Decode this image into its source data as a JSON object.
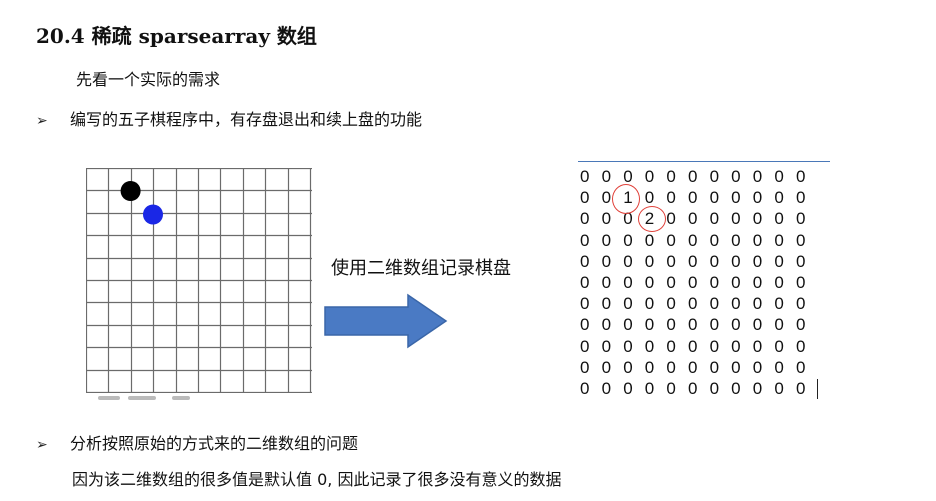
{
  "heading": "20.4  稀疏 sparsearray 数组",
  "intro": "先看一个实际的需求",
  "bullets": [
    {
      "mark": "➢",
      "text": "编写的五子棋程序中，有存盘退出和续上盘的功能"
    },
    {
      "mark": "➢",
      "text": "分析按照原始的方式来的二维数组的问题"
    }
  ],
  "note": "因为该二维数组的很多值是默认值 0, 因此记录了很多没有意义的数据",
  "arrow_label": "使用二维数组记录棋盘",
  "board": {
    "grid_color": "#6b6b6b",
    "black_piece_color": "#000000",
    "blue_piece_color": "#1a27e6"
  },
  "arrow_color": "#4a7ac4",
  "matrix": [
    [
      "0",
      "0",
      "0",
      "0",
      "0",
      "0",
      "0",
      "0",
      "0",
      "0",
      "0"
    ],
    [
      "0",
      "0",
      "1",
      "0",
      "0",
      "0",
      "0",
      "0",
      "0",
      "0",
      "0"
    ],
    [
      "0",
      "0",
      "0",
      "2",
      "0",
      "0",
      "0",
      "0",
      "0",
      "0",
      "0"
    ],
    [
      "0",
      "0",
      "0",
      "0",
      "0",
      "0",
      "0",
      "0",
      "0",
      "0",
      "0"
    ],
    [
      "0",
      "0",
      "0",
      "0",
      "0",
      "0",
      "0",
      "0",
      "0",
      "0",
      "0"
    ],
    [
      "0",
      "0",
      "0",
      "0",
      "0",
      "0",
      "0",
      "0",
      "0",
      "0",
      "0"
    ],
    [
      "0",
      "0",
      "0",
      "0",
      "0",
      "0",
      "0",
      "0",
      "0",
      "0",
      "0"
    ],
    [
      "0",
      "0",
      "0",
      "0",
      "0",
      "0",
      "0",
      "0",
      "0",
      "0",
      "0"
    ],
    [
      "0",
      "0",
      "0",
      "0",
      "0",
      "0",
      "0",
      "0",
      "0",
      "0",
      "0"
    ],
    [
      "0",
      "0",
      "0",
      "0",
      "0",
      "0",
      "0",
      "0",
      "0",
      "0",
      "0"
    ],
    [
      "0",
      "0",
      "0",
      "0",
      "0",
      "0",
      "0",
      "0",
      "0",
      "0",
      "0"
    ]
  ],
  "highlight_color": "#e0413a"
}
